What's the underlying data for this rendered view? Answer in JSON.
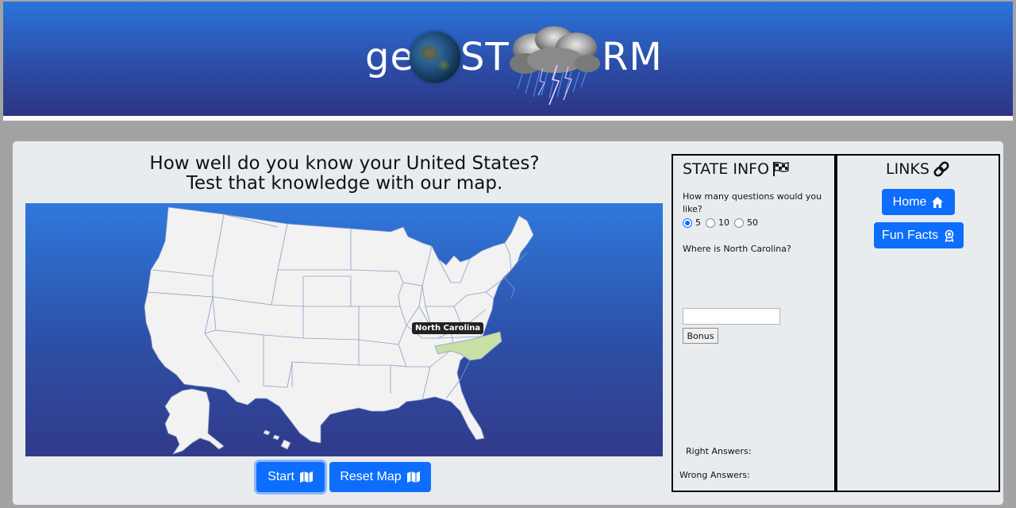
{
  "header": {
    "logo": {
      "part1": "ge",
      "part2": "ST",
      "part3": "RM"
    }
  },
  "main": {
    "heading_line1": "How well do you know your United States?",
    "heading_line2": "Test that knowledge with our map.",
    "map": {
      "tooltip": "North Carolina",
      "highlight_color": "#c8dfa8",
      "state_color": "#f2f2f2",
      "border_color": "#8a9cc4"
    },
    "buttons": {
      "start": "Start",
      "reset": "Reset Map"
    }
  },
  "state_info": {
    "title": "STATE INFO",
    "question": "How many questions would you like?",
    "options": [
      "5",
      "10",
      "50"
    ],
    "selected_option": "5",
    "prompt": "Where is North Carolina?",
    "answer_value": "",
    "bonus_label": "Bonus",
    "right_answers": "Right Answers:",
    "wrong_answers": "Wrong Answers:"
  },
  "links": {
    "title": "LINKS",
    "home": "Home",
    "fun_facts": "Fun Facts"
  },
  "colors": {
    "primary": "#0d6efd",
    "header_top": "#2a74db",
    "header_bottom": "#2d3483",
    "panel_bg": "#e9ecef"
  }
}
